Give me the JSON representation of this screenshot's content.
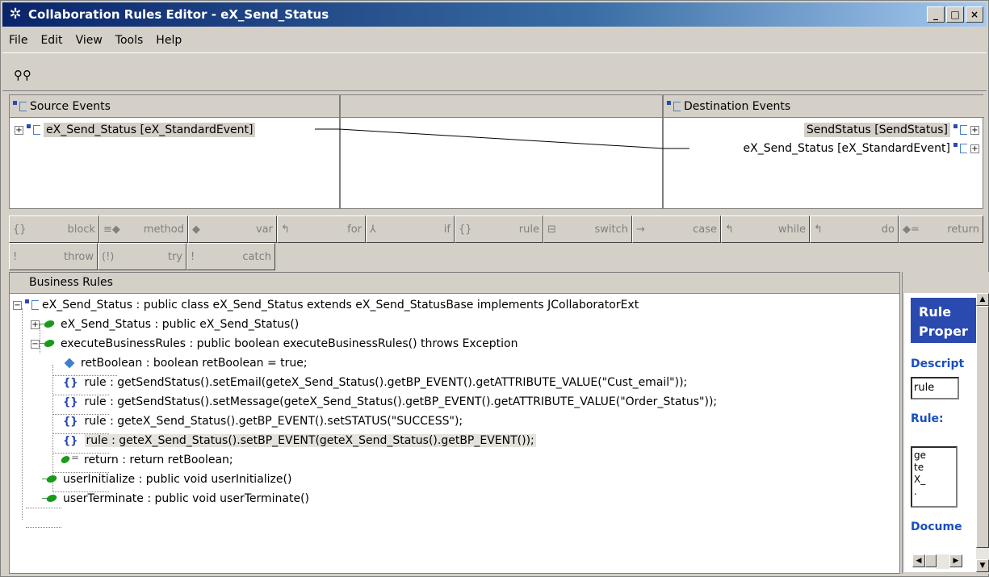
{
  "window": {
    "title": "Collaboration Rules Editor - eX_Send_Status",
    "min": "_",
    "max": "□",
    "close": "×"
  },
  "menu": [
    "File",
    "Edit",
    "View",
    "Tools",
    "Help"
  ],
  "mapper": {
    "source_header": "Source Events",
    "source_item": "eX_Send_Status [eX_StandardEvent]",
    "dest_header": "Destination Events",
    "dest_items": [
      "SendStatus [SendStatus]",
      "eX_Send_Status [eX_StandardEvent]"
    ]
  },
  "rule_toolbar": {
    "row1": [
      {
        "glyph": "{}",
        "label": "block"
      },
      {
        "glyph": "≡◆",
        "label": "method"
      },
      {
        "glyph": "◆",
        "label": "var"
      },
      {
        "glyph": "↰",
        "label": "for"
      },
      {
        "glyph": "⅄",
        "label": "if"
      },
      {
        "glyph": "{}",
        "label": "rule"
      },
      {
        "glyph": "⊟",
        "label": "switch"
      },
      {
        "glyph": "→",
        "label": "case"
      },
      {
        "glyph": "↰",
        "label": "while"
      },
      {
        "glyph": "↰",
        "label": "do"
      },
      {
        "glyph": "◆=",
        "label": "return"
      }
    ],
    "row2": [
      {
        "glyph": "!",
        "label": "throw"
      },
      {
        "glyph": "(!)",
        "label": "try"
      },
      {
        "glyph": "!",
        "label": "catch"
      }
    ]
  },
  "business_rules": {
    "header": "Business Rules",
    "class_node": "eX_Send_Status : public class eX_Send_Status extends eX_Send_StatusBase implements JCollaboratorExt",
    "constructor": "eX_Send_Status : public  eX_Send_Status()",
    "execute": "executeBusinessRules : public boolean executeBusinessRules() throws Exception",
    "var": "retBoolean : boolean retBoolean = true;",
    "rules": [
      "rule : getSendStatus().setEmail(geteX_Send_Status().getBP_EVENT().getATTRIBUTE_VALUE(\"Cust_email\"));",
      "rule : getSendStatus().setMessage(geteX_Send_Status().getBP_EVENT().getATTRIBUTE_VALUE(\"Order_Status\"));",
      "rule : geteX_Send_Status().getBP_EVENT().setSTATUS(\"SUCCESS\");",
      "rule : geteX_Send_Status().setBP_EVENT(geteX_Send_Status().getBP_EVENT());"
    ],
    "return_node": "return : return retBoolean;",
    "init": "userInitialize : public void userInitialize()",
    "term": "userTerminate : public void userTerminate()"
  },
  "properties": {
    "title_line1": "Rule",
    "title_line2": "Proper",
    "description_label": "Descript",
    "description_value": "rule",
    "rule_label": "Rule:",
    "rule_text": "ge\nte\nX_\n.",
    "document_label": "Docume"
  }
}
